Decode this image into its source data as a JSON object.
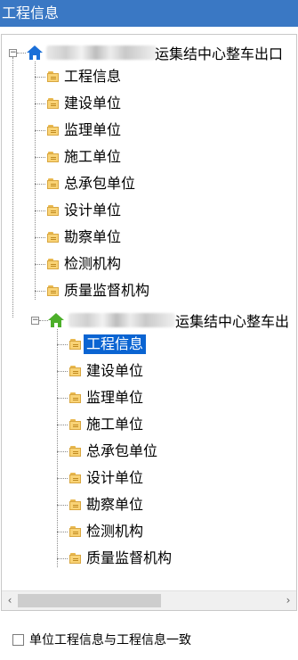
{
  "window": {
    "title": "工程信息"
  },
  "tree": {
    "root1": {
      "label": "运集结中心整车出口",
      "children": [
        "工程信息",
        "建设单位",
        "监理单位",
        "施工单位",
        "总承包单位",
        "设计单位",
        "勘察单位",
        "检测机构",
        "质量监督机构"
      ]
    },
    "root2": {
      "label": "运集结中心整车出",
      "children": [
        "工程信息",
        "建设单位",
        "监理单位",
        "施工单位",
        "总承包单位",
        "设计单位",
        "勘察单位",
        "检测机构",
        "质量监督机构"
      ],
      "selected_child": "工程信息"
    }
  },
  "scrollbar": {
    "left_arrow": "‹",
    "right_arrow": "›"
  },
  "options": {
    "sync_checkbox_label": "单位工程信息与工程信息一致",
    "sync_checked": false
  },
  "colors": {
    "title_bar": "#3a78c4",
    "selection": "#0a64d2",
    "root1_icon": "#1a6fd8",
    "root2_icon": "#4caf2a"
  },
  "icons": {
    "root1": "home-icon",
    "root2": "home-icon",
    "child": "folder-icon",
    "expander": "minus-box-icon"
  }
}
